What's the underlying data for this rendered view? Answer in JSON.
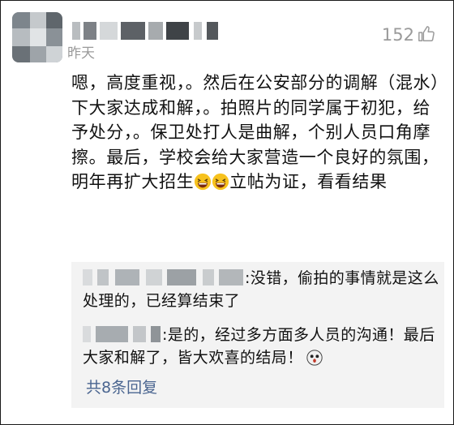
{
  "comment": {
    "time": "昨天",
    "likes": "152",
    "text_parts": {
      "main": "嗯，高度重视，。然后在公安部分的调解（混水）下大家达成和解，。拍照片的同学属于初犯，给予处分，。保卫处打人是曲解，个别人员口角摩擦。最后，学校会给大家营造一个良好的氛围，明年再扩大招生",
      "emoji_1": "grinning-squint-emoji",
      "emoji_2": "grinning-squint-emoji",
      "tail": "立帖为证，看看结果"
    }
  },
  "replies": [
    {
      "text": ":没错，偷拍的事情就是这么处理的，已经算结束了"
    },
    {
      "text": ":是的，经过多方面多人员的沟通！最后大家和解了，皆大欢喜的结局！",
      "emoji": "surprised-face-emoji"
    }
  ],
  "more_replies": "共8条回复",
  "colors": {
    "muted": "#9a9a9a",
    "link": "#4a6590",
    "reply_bg": "#f3f3f3",
    "emoji_yellow": "#f7c21e"
  }
}
